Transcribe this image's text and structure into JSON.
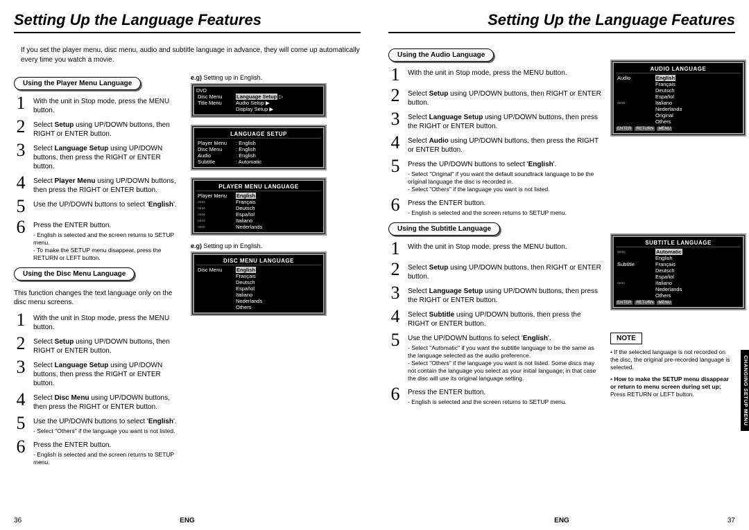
{
  "titleLeft": "Setting Up the Language Features",
  "titleRight": "Setting Up the Language Features",
  "intro": "If you set the player menu, disc menu, audio and subtitle language in advance, they will come up automatically every time you watch a movie.",
  "eg": "e.g) Setting up in English.",
  "secPlayer": "Using the Player Menu Language",
  "secDisc": "Using the Disc Menu Language",
  "secAudio": "Using the Audio Language",
  "secSubtitle": "Using the Subtitle Language",
  "discIntro": "This function changes the text language only on the disc menu screens.",
  "step1": "With the unit in Stop mode, press the MENU button.",
  "step2a": "Select ",
  "step2b": "Setup",
  "step2c": " using UP/DOWN buttons, then RIGHT or ENTER button.",
  "step3a": "Select ",
  "step3b": "Language Setup",
  "step3c": " using UP/DOWN buttons, then press the RIGHT or ENTER button.",
  "player4a": "Select ",
  "player4b": "Player Menu",
  "player4c": " using UP/DOWN buttons, then press the RIGHT or ENTER button.",
  "disc4b": "Disc Menu",
  "audio4b": "Audio",
  "subtitle4b": "Subtitle",
  "step4suffix_press": " using UP/DOWN buttons, then press the RIGHT or ENTER button.",
  "step5a": "Use the UP/DOWN buttons to select '",
  "step5b": "English",
  "step5c": "'.",
  "step5audio": "Press the UP/DOWN buttons to select 'English'.",
  "discNote1": "Select \"Others\" if the language you want is not listed.",
  "audioNote1": "Select \"Original\" if you want the default soundtrack language to be the original language the disc is recorded in.",
  "audioNote2": "Select \"Others\" if the language you want is not listed.",
  "subNote1": "Select \"Automatic\" if you want the subtitle language to be the same as the language selected as the audio preference.",
  "subNote2": "Select \"Others\" if the language you want is not listed. Some discs may not contain the language you  select as your initial language; in that case the disc will use its original language setting.",
  "step6": "Press the ENTER button.",
  "step6noteA": "English is selected and the screen returns to SETUP menu.",
  "step6noteB": "To make the SETUP menu disappear, press the RETURN or LEFT button.",
  "noteLabel": "NOTE",
  "noteBody1": "• If the selected language is not recorded on the disc, the original pre-recorded language is selected.",
  "noteBody2a": "• ",
  "noteBody2b": "How to make the SETUP menu disappear or return to menu screen during set up;",
  "noteBody2c": " Press RETURN or LEFT button.",
  "pageLeft": "36",
  "pageRight": "37",
  "eng": "ENG",
  "sideTab": "CHANGING SETUP MENU",
  "osd": {
    "setup_title": "",
    "dvd": "DVD",
    "items": [
      "Disc Menu",
      "Title Menu"
    ],
    "langSetup": "Language Setup",
    "audioSetup": "Audio Setup",
    "displaySetup": "Display Setup",
    "ls_title": "LANGUAGE SETUP",
    "ls_rows": [
      [
        "Player Menu",
        ": English"
      ],
      [
        "Disc Menu",
        ": English"
      ],
      [
        "Audio",
        ": English"
      ],
      [
        "Subtitle",
        ": Automatic"
      ]
    ],
    "pml_title": "PLAYER MENU LANGUAGE",
    "pml_key": "Player Menu",
    "pml_hl": "English",
    "langs": [
      "Français",
      "Deutsch",
      "Español",
      "Italiano",
      "Nederlands"
    ],
    "dml_title": "DISC MENU LANGUAGE",
    "dml_key": "Disc Menu",
    "dml_langs": [
      "Français",
      "Deutsch",
      "Español",
      "Italiano",
      "Nederlands",
      "Others"
    ],
    "aud_title": "AUDIO LANGUAGE",
    "aud_key": "Audio",
    "aud_langs": [
      "Français",
      "Deutsch",
      "Español",
      "Italiano",
      "Nederlands",
      "Original",
      "Others"
    ],
    "sub_title": "SUBTITLE LANGUAGE",
    "sub_key": "Subtitle",
    "sub_hl": "Automatic",
    "sub_langs": [
      "English",
      "Français",
      "Deutsch",
      "Español",
      "Italiano",
      "Nederlands",
      "Others"
    ],
    "btns": [
      "ENTER",
      "RETURN",
      "MENU"
    ]
  }
}
